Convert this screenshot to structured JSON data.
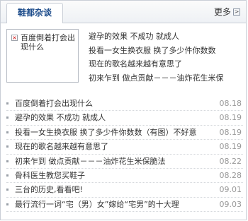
{
  "header": {
    "tab_label": "鞋都杂谈",
    "more_label": "更多",
    "more_icon": ">"
  },
  "feature": {
    "thumb_text": "百度倒着打会出现什么",
    "items": [
      "避孕的效果 不成功 就成人",
      "投看一女生换衣服 换了多少件你数数",
      "现在的歌名越来越有意思了",
      "初来乍到 做点贡献－－－油炸花生米保"
    ]
  },
  "list": [
    {
      "title": "百度倒着打会出现什么",
      "date": "08.18"
    },
    {
      "title": "避孕的效果 不成功 就成人",
      "date": "08.19"
    },
    {
      "title": "投看一女生换衣服 换了多少件你数数（有图）不好意",
      "date": "08.19"
    },
    {
      "title": "现在的歌名越来越有意思了",
      "date": "08.19"
    },
    {
      "title": "初来乍到 做点贡献－－－油炸花生米保脆法",
      "date": "08.22"
    },
    {
      "title": "骨科医生教您买鞋子",
      "date": "08.28"
    },
    {
      "title": "三台的历史,看看吧!",
      "date": "09.01"
    },
    {
      "title": "最行流行一词“宅（男）女”嫁给“宅男”的十大理",
      "date": "09.03"
    }
  ]
}
